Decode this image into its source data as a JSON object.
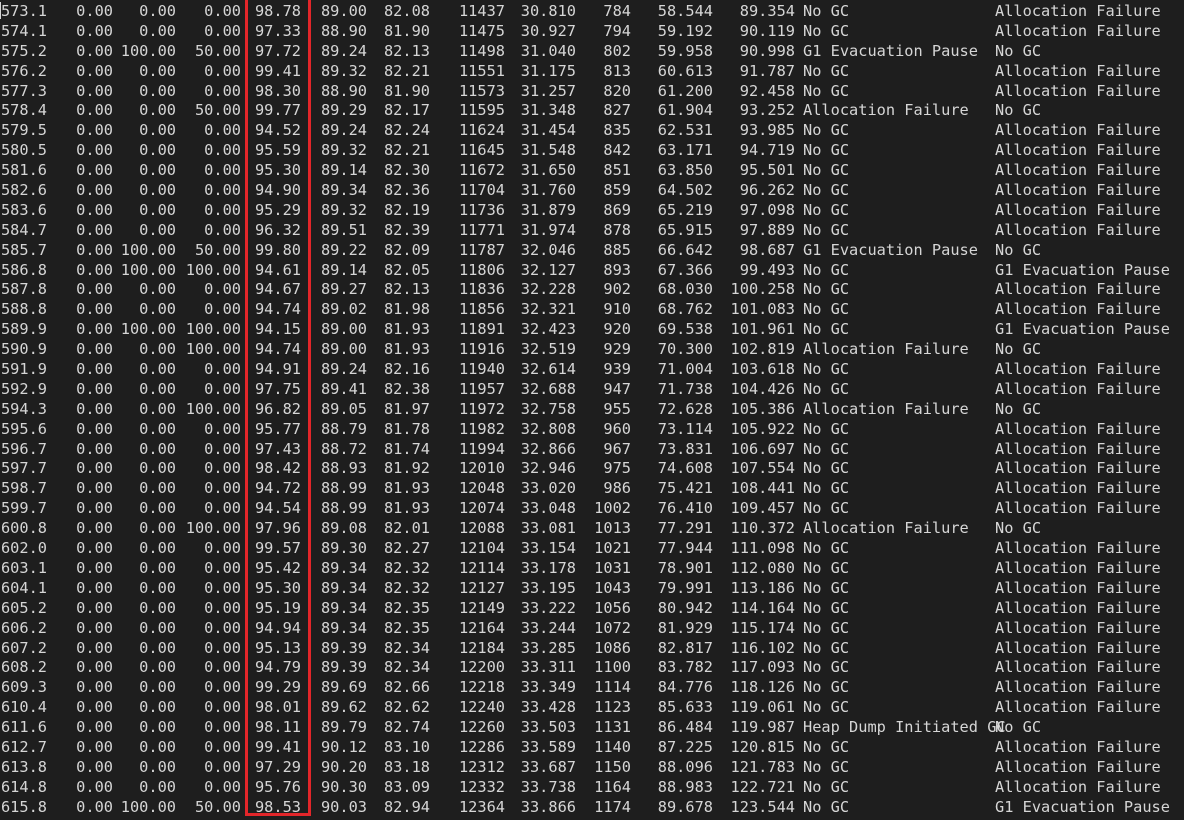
{
  "highlight_color": "#e3262a",
  "background_color": "#1e1e1e",
  "text_color": "#d6d6d6",
  "rows": [
    [
      "573.1",
      "0.00",
      "0.00",
      "0.00",
      "98.78",
      "89.00",
      "82.08",
      "11437",
      "30.810",
      "784",
      "58.544",
      "89.354",
      "No GC",
      "Allocation Failure"
    ],
    [
      "574.1",
      "0.00",
      "0.00",
      "0.00",
      "97.33",
      "88.90",
      "81.90",
      "11475",
      "30.927",
      "794",
      "59.192",
      "90.119",
      "No GC",
      "Allocation Failure"
    ],
    [
      "575.2",
      "0.00",
      "100.00",
      "50.00",
      "97.72",
      "89.24",
      "82.13",
      "11498",
      "31.040",
      "802",
      "59.958",
      "90.998",
      "G1 Evacuation Pause",
      "No GC"
    ],
    [
      "576.2",
      "0.00",
      "0.00",
      "0.00",
      "99.41",
      "89.32",
      "82.21",
      "11551",
      "31.175",
      "813",
      "60.613",
      "91.787",
      "No GC",
      "Allocation Failure"
    ],
    [
      "577.3",
      "0.00",
      "0.00",
      "0.00",
      "98.30",
      "88.90",
      "81.90",
      "11573",
      "31.257",
      "820",
      "61.200",
      "92.458",
      "No GC",
      "Allocation Failure"
    ],
    [
      "578.4",
      "0.00",
      "0.00",
      "50.00",
      "99.77",
      "89.29",
      "82.17",
      "11595",
      "31.348",
      "827",
      "61.904",
      "93.252",
      "Allocation Failure",
      "No GC"
    ],
    [
      "579.5",
      "0.00",
      "0.00",
      "0.00",
      "94.52",
      "89.24",
      "82.24",
      "11624",
      "31.454",
      "835",
      "62.531",
      "93.985",
      "No GC",
      "Allocation Failure"
    ],
    [
      "580.5",
      "0.00",
      "0.00",
      "0.00",
      "95.59",
      "89.32",
      "82.21",
      "11645",
      "31.548",
      "842",
      "63.171",
      "94.719",
      "No GC",
      "Allocation Failure"
    ],
    [
      "581.6",
      "0.00",
      "0.00",
      "0.00",
      "95.30",
      "89.14",
      "82.30",
      "11672",
      "31.650",
      "851",
      "63.850",
      "95.501",
      "No GC",
      "Allocation Failure"
    ],
    [
      "582.6",
      "0.00",
      "0.00",
      "0.00",
      "94.90",
      "89.34",
      "82.36",
      "11704",
      "31.760",
      "859",
      "64.502",
      "96.262",
      "No GC",
      "Allocation Failure"
    ],
    [
      "583.6",
      "0.00",
      "0.00",
      "0.00",
      "95.29",
      "89.32",
      "82.19",
      "11736",
      "31.879",
      "869",
      "65.219",
      "97.098",
      "No GC",
      "Allocation Failure"
    ],
    [
      "584.7",
      "0.00",
      "0.00",
      "0.00",
      "96.32",
      "89.51",
      "82.39",
      "11771",
      "31.974",
      "878",
      "65.915",
      "97.889",
      "No GC",
      "Allocation Failure"
    ],
    [
      "585.7",
      "0.00",
      "100.00",
      "50.00",
      "99.80",
      "89.22",
      "82.09",
      "11787",
      "32.046",
      "885",
      "66.642",
      "98.687",
      "G1 Evacuation Pause",
      "No GC"
    ],
    [
      "586.8",
      "0.00",
      "100.00",
      "100.00",
      "94.61",
      "89.14",
      "82.05",
      "11806",
      "32.127",
      "893",
      "67.366",
      "99.493",
      "No GC",
      "G1 Evacuation Pause"
    ],
    [
      "587.8",
      "0.00",
      "0.00",
      "0.00",
      "94.67",
      "89.27",
      "82.13",
      "11836",
      "32.228",
      "902",
      "68.030",
      "100.258",
      "No GC",
      "Allocation Failure"
    ],
    [
      "588.8",
      "0.00",
      "0.00",
      "0.00",
      "94.74",
      "89.02",
      "81.98",
      "11856",
      "32.321",
      "910",
      "68.762",
      "101.083",
      "No GC",
      "Allocation Failure"
    ],
    [
      "589.9",
      "0.00",
      "100.00",
      "100.00",
      "94.15",
      "89.00",
      "81.93",
      "11891",
      "32.423",
      "920",
      "69.538",
      "101.961",
      "No GC",
      "G1 Evacuation Pause"
    ],
    [
      "590.9",
      "0.00",
      "0.00",
      "100.00",
      "94.74",
      "89.00",
      "81.93",
      "11916",
      "32.519",
      "929",
      "70.300",
      "102.819",
      "Allocation Failure",
      "No GC"
    ],
    [
      "591.9",
      "0.00",
      "0.00",
      "0.00",
      "94.91",
      "89.24",
      "82.16",
      "11940",
      "32.614",
      "939",
      "71.004",
      "103.618",
      "No GC",
      "Allocation Failure"
    ],
    [
      "592.9",
      "0.00",
      "0.00",
      "0.00",
      "97.75",
      "89.41",
      "82.38",
      "11957",
      "32.688",
      "947",
      "71.738",
      "104.426",
      "No GC",
      "Allocation Failure"
    ],
    [
      "594.3",
      "0.00",
      "0.00",
      "100.00",
      "96.82",
      "89.05",
      "81.97",
      "11972",
      "32.758",
      "955",
      "72.628",
      "105.386",
      "Allocation Failure",
      "No GC"
    ],
    [
      "595.6",
      "0.00",
      "0.00",
      "0.00",
      "95.77",
      "88.79",
      "81.78",
      "11982",
      "32.808",
      "960",
      "73.114",
      "105.922",
      "No GC",
      "Allocation Failure"
    ],
    [
      "596.7",
      "0.00",
      "0.00",
      "0.00",
      "97.43",
      "88.72",
      "81.74",
      "11994",
      "32.866",
      "967",
      "73.831",
      "106.697",
      "No GC",
      "Allocation Failure"
    ],
    [
      "597.7",
      "0.00",
      "0.00",
      "0.00",
      "98.42",
      "88.93",
      "81.92",
      "12010",
      "32.946",
      "975",
      "74.608",
      "107.554",
      "No GC",
      "Allocation Failure"
    ],
    [
      "598.7",
      "0.00",
      "0.00",
      "0.00",
      "94.72",
      "88.99",
      "81.93",
      "12048",
      "33.020",
      "986",
      "75.421",
      "108.441",
      "No GC",
      "Allocation Failure"
    ],
    [
      "599.7",
      "0.00",
      "0.00",
      "0.00",
      "94.54",
      "88.99",
      "81.93",
      "12074",
      "33.048",
      "1002",
      "76.410",
      "109.457",
      "No GC",
      "Allocation Failure"
    ],
    [
      "600.8",
      "0.00",
      "0.00",
      "100.00",
      "97.96",
      "89.08",
      "82.01",
      "12088",
      "33.081",
      "1013",
      "77.291",
      "110.372",
      "Allocation Failure",
      "No GC"
    ],
    [
      "602.0",
      "0.00",
      "0.00",
      "0.00",
      "99.57",
      "89.30",
      "82.27",
      "12104",
      "33.154",
      "1021",
      "77.944",
      "111.098",
      "No GC",
      "Allocation Failure"
    ],
    [
      "603.1",
      "0.00",
      "0.00",
      "0.00",
      "95.42",
      "89.34",
      "82.32",
      "12114",
      "33.178",
      "1031",
      "78.901",
      "112.080",
      "No GC",
      "Allocation Failure"
    ],
    [
      "604.1",
      "0.00",
      "0.00",
      "0.00",
      "95.30",
      "89.34",
      "82.32",
      "12127",
      "33.195",
      "1043",
      "79.991",
      "113.186",
      "No GC",
      "Allocation Failure"
    ],
    [
      "605.2",
      "0.00",
      "0.00",
      "0.00",
      "95.19",
      "89.34",
      "82.35",
      "12149",
      "33.222",
      "1056",
      "80.942",
      "114.164",
      "No GC",
      "Allocation Failure"
    ],
    [
      "606.2",
      "0.00",
      "0.00",
      "0.00",
      "94.94",
      "89.34",
      "82.35",
      "12164",
      "33.244",
      "1072",
      "81.929",
      "115.174",
      "No GC",
      "Allocation Failure"
    ],
    [
      "607.2",
      "0.00",
      "0.00",
      "0.00",
      "95.13",
      "89.39",
      "82.34",
      "12184",
      "33.285",
      "1086",
      "82.817",
      "116.102",
      "No GC",
      "Allocation Failure"
    ],
    [
      "608.2",
      "0.00",
      "0.00",
      "0.00",
      "94.79",
      "89.39",
      "82.34",
      "12200",
      "33.311",
      "1100",
      "83.782",
      "117.093",
      "No GC",
      "Allocation Failure"
    ],
    [
      "609.3",
      "0.00",
      "0.00",
      "0.00",
      "99.29",
      "89.69",
      "82.66",
      "12218",
      "33.349",
      "1114",
      "84.776",
      "118.126",
      "No GC",
      "Allocation Failure"
    ],
    [
      "610.4",
      "0.00",
      "0.00",
      "0.00",
      "98.01",
      "89.62",
      "82.62",
      "12240",
      "33.428",
      "1123",
      "85.633",
      "119.061",
      "No GC",
      "Allocation Failure"
    ],
    [
      "611.6",
      "0.00",
      "0.00",
      "0.00",
      "98.11",
      "89.79",
      "82.74",
      "12260",
      "33.503",
      "1131",
      "86.484",
      "119.987",
      "Heap Dump Initiated GC",
      "No GC"
    ],
    [
      "612.7",
      "0.00",
      "0.00",
      "0.00",
      "99.41",
      "90.12",
      "83.10",
      "12286",
      "33.589",
      "1140",
      "87.225",
      "120.815",
      "No GC",
      "Allocation Failure"
    ],
    [
      "613.8",
      "0.00",
      "0.00",
      "0.00",
      "97.29",
      "90.20",
      "83.18",
      "12312",
      "33.687",
      "1150",
      "88.096",
      "121.783",
      "No GC",
      "Allocation Failure"
    ],
    [
      "614.8",
      "0.00",
      "0.00",
      "0.00",
      "95.76",
      "90.30",
      "83.09",
      "12332",
      "33.738",
      "1164",
      "88.983",
      "122.721",
      "No GC",
      "Allocation Failure"
    ],
    [
      "615.8",
      "0.00",
      "100.00",
      "50.00",
      "98.53",
      "90.03",
      "82.94",
      "12364",
      "33.866",
      "1174",
      "89.678",
      "123.544",
      "No GC",
      "G1 Evacuation Pause"
    ]
  ]
}
